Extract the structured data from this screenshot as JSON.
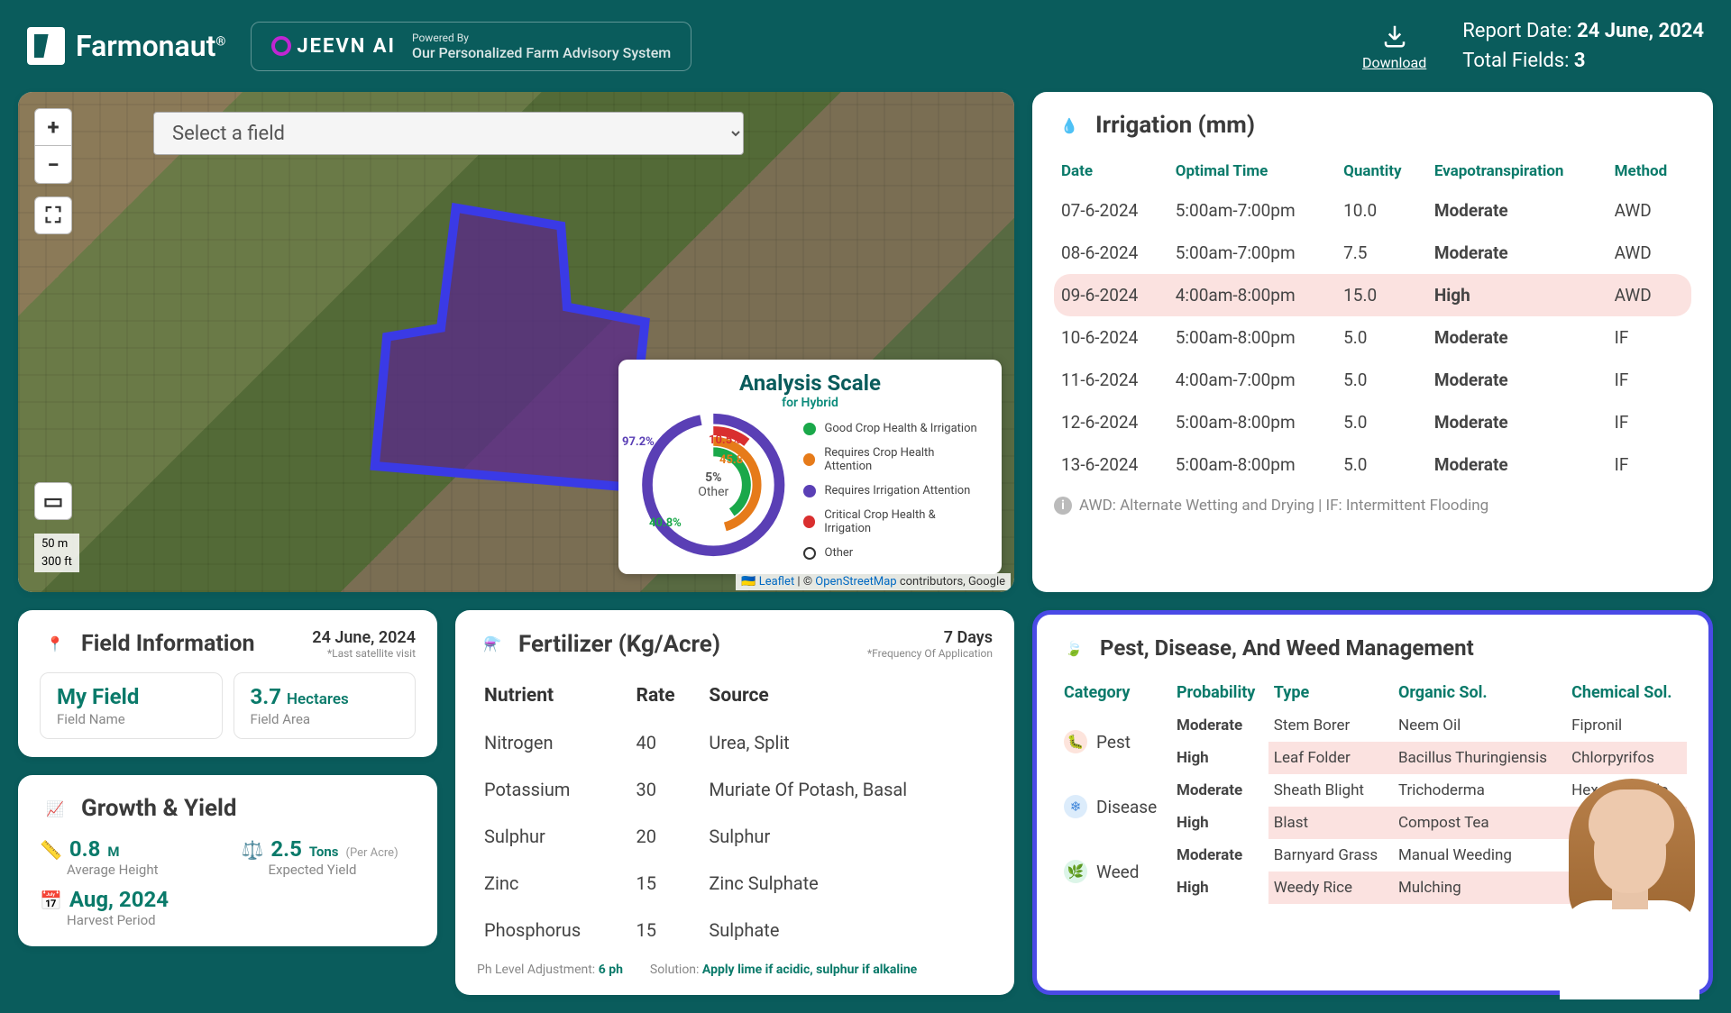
{
  "header": {
    "brand": "Farmonaut",
    "brand_sup": "®",
    "jeevn_logo": "JEEVN AI",
    "jeevn_powered": "Powered By",
    "jeevn_desc": "Our Personalized Farm Advisory System",
    "download": "Download",
    "report_date_label": "Report Date:",
    "report_date": "24 June, 2024",
    "total_fields_label": "Total Fields:",
    "total_fields": "3"
  },
  "map": {
    "select_placeholder": "Select a field",
    "scale_title": "Analysis Scale",
    "scale_sub": "for Hybrid",
    "donut_center_pct": "5%",
    "donut_center_lbl": "Other",
    "donut_labels": {
      "purple": "97.2%",
      "orange_top": "10.5%",
      "orange_mid": "45.8%",
      "green": "40.8%"
    },
    "legend": [
      {
        "color": "#1aa84a",
        "label": "Good Crop Health & Irrigation"
      },
      {
        "color": "#e67b1a",
        "label": "Requires Crop Health Attention"
      },
      {
        "color": "#5a3fb5",
        "label": "Requires Irrigation Attention"
      },
      {
        "color": "#d92f2f",
        "label": "Critical Crop Health & Irrigation"
      },
      {
        "color": "#ffffff",
        "label": "Other",
        "hollow": true
      }
    ],
    "scale_m": "50 m",
    "scale_ft": "300 ft",
    "attrib_leaflet": "Leaflet",
    "attrib_osm": "OpenStreetMap",
    "attrib_tail": " contributors, Google"
  },
  "field_info": {
    "title": "Field Information",
    "date": "24 June, 2024",
    "date_sub": "*Last satellite visit",
    "name_val": "My Field",
    "name_lbl": "Field Name",
    "area_val": "3.7",
    "area_unit": "Hectares",
    "area_lbl": "Field Area"
  },
  "growth": {
    "title": "Growth & Yield",
    "height_val": "0.8",
    "height_unit": "M",
    "height_lbl": "Average Height",
    "yield_val": "2.5",
    "yield_unit": "Tons",
    "yield_unit2": "(Per Acre)",
    "yield_lbl": "Expected Yield",
    "harvest_val": "Aug, 2024",
    "harvest_lbl": "Harvest Period"
  },
  "fertilizer": {
    "title": "Fertilizer (Kg/Acre)",
    "meta": "7 Days",
    "meta_sub": "*Frequency Of Application",
    "cols": [
      "Nutrient",
      "Rate",
      "Source"
    ],
    "rows": [
      {
        "n": "Nitrogen",
        "r": "40",
        "s": "Urea, Split"
      },
      {
        "n": "Potassium",
        "r": "30",
        "s": "Muriate Of Potash, Basal"
      },
      {
        "n": "Sulphur",
        "r": "20",
        "s": "Sulphur"
      },
      {
        "n": "Zinc",
        "r": "15",
        "s": "Zinc Sulphate"
      },
      {
        "n": "Phosphorus",
        "r": "15",
        "s": "Sulphate"
      }
    ],
    "ph_lbl": "Ph Level Adjustment:",
    "ph_val": "6 ph",
    "sol_lbl": "Solution:",
    "sol_val": "Apply lime if acidic, sulphur if alkaline"
  },
  "irrigation": {
    "title": "Irrigation (mm)",
    "cols": [
      "Date",
      "Optimal Time",
      "Quantity",
      "Evapotranspiration",
      "Method"
    ],
    "rows": [
      {
        "d": "07-6-2024",
        "t": "5:00am-7:00pm",
        "q": "10.0",
        "e": "Moderate",
        "m": "AWD"
      },
      {
        "d": "08-6-2024",
        "t": "5:00am-7:00pm",
        "q": "7.5",
        "e": "Moderate",
        "m": "AWD"
      },
      {
        "d": "09-6-2024",
        "t": "4:00am-8:00pm",
        "q": "15.0",
        "e": "High",
        "m": "AWD",
        "hi": true
      },
      {
        "d": "10-6-2024",
        "t": "5:00am-8:00pm",
        "q": "5.0",
        "e": "Moderate",
        "m": "IF"
      },
      {
        "d": "11-6-2024",
        "t": "4:00am-7:00pm",
        "q": "5.0",
        "e": "Moderate",
        "m": "IF"
      },
      {
        "d": "12-6-2024",
        "t": "5:00am-8:00pm",
        "q": "5.0",
        "e": "Moderate",
        "m": "IF"
      },
      {
        "d": "13-6-2024",
        "t": "5:00am-8:00pm",
        "q": "5.0",
        "e": "Moderate",
        "m": "IF"
      }
    ],
    "note": "AWD: Alternate Wetting and Drying | IF: Intermittent Flooding"
  },
  "pest": {
    "title": "Pest, Disease, And Weed Management",
    "cols": [
      "Category",
      "Probability",
      "Type",
      "Organic Sol.",
      "Chemical Sol."
    ],
    "groups": [
      {
        "cat": "Pest",
        "ico": "pest",
        "rows": [
          {
            "p": "Moderate",
            "t": "Stem Borer",
            "o": "Neem Oil",
            "c": "Fipronil"
          },
          {
            "p": "High",
            "t": "Leaf Folder",
            "o": "Bacillus Thuringiensis",
            "c": "Chlorpyrifos"
          }
        ]
      },
      {
        "cat": "Disease",
        "ico": "dis",
        "rows": [
          {
            "p": "Moderate",
            "t": "Sheath Blight",
            "o": "Trichoderma",
            "c": "Hexaconazole"
          },
          {
            "p": "High",
            "t": "Blast",
            "o": "Compost Tea",
            "c": ""
          }
        ]
      },
      {
        "cat": "Weed",
        "ico": "weed",
        "rows": [
          {
            "p": "Moderate",
            "t": "Barnyard Grass",
            "o": "Manual Weeding",
            "c": ""
          },
          {
            "p": "High",
            "t": "Weedy Rice",
            "o": "Mulching",
            "c": ""
          }
        ]
      }
    ]
  }
}
